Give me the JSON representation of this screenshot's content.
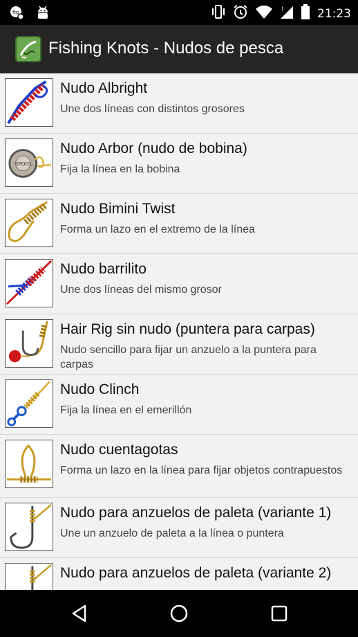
{
  "status_bar": {
    "time": "21:23",
    "left_icons": [
      "notification-app-icon",
      "android-debug-icon"
    ],
    "right_icons": [
      "vibrate-icon",
      "alarm-icon",
      "wifi-icon",
      "no-sim-icon",
      "battery-icon"
    ]
  },
  "app_bar": {
    "title": "Fishing Knots - Nudos de pesca",
    "logo_icon": "fishing-knots-logo-icon"
  },
  "knots": [
    {
      "name": "Nudo Albright",
      "desc": "Une dos líneas con distintos grosores",
      "icon": "albright-knot-icon"
    },
    {
      "name": "Nudo Arbor (nudo de bobina)",
      "desc": "Fija la línea en la bobina",
      "icon": "arbor-knot-icon"
    },
    {
      "name": "Nudo Bimini Twist",
      "desc": "Forma un lazo en el extremo de la línea",
      "icon": "bimini-twist-icon"
    },
    {
      "name": "Nudo barrilito",
      "desc": "Une dos líneas del mismo grosor",
      "icon": "barrel-knot-icon"
    },
    {
      "name": "Hair Rig sin nudo (puntera para carpas)",
      "desc": "Nudo sencillo para fijar un anzuelo a la puntera para carpas",
      "icon": "hair-rig-icon"
    },
    {
      "name": "Nudo Clinch",
      "desc": "Fija la línea en el emerillón",
      "icon": "clinch-knot-icon"
    },
    {
      "name": "Nudo cuentagotas",
      "desc": "Forma un lazo en la línea para fijar objetos contrapuestos",
      "icon": "dropper-loop-icon"
    },
    {
      "name": "Nudo para anzuelos de paleta (variante 1)",
      "desc": "Une un anzuelo de paleta a la línea o puntera",
      "icon": "spade-end-hook-icon"
    },
    {
      "name": "Nudo para anzuelos de paleta (variante 2)",
      "desc": "",
      "icon": "spade-end-hook-icon"
    }
  ],
  "nav_bar": {
    "back_icon": "back-icon",
    "home_icon": "home-icon",
    "recents_icon": "recents-icon"
  }
}
